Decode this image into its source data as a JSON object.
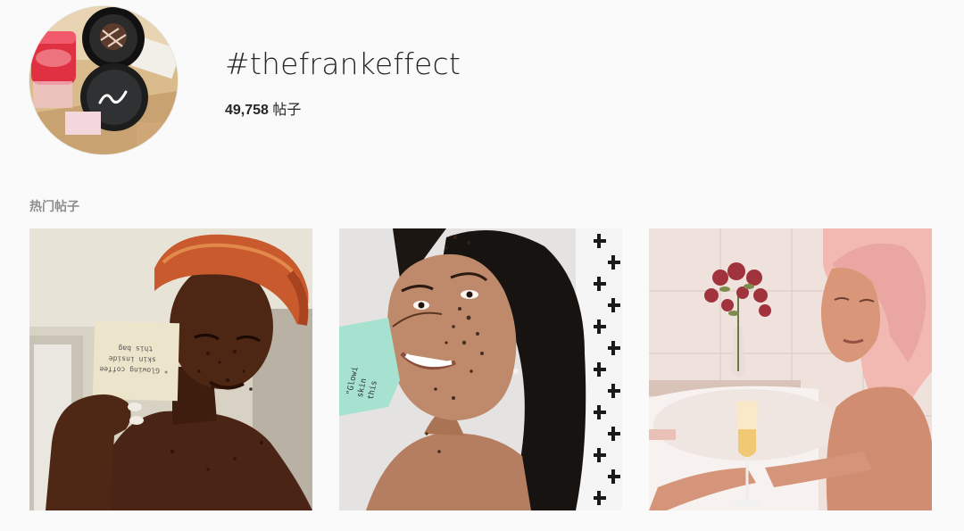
{
  "header": {
    "hashtag": "#thefrankeffect",
    "post_count": "49,758",
    "post_count_unit": "帖子"
  },
  "top_posts": {
    "section_label": "热门帖子",
    "posts": [
      {
        "photo_text": [
          "* Glowing coffee",
          "skin inside",
          "this bag"
        ]
      },
      {
        "photo_text": [
          "\"Glowi",
          "skin",
          "this"
        ]
      },
      {
        "photo_text": []
      }
    ]
  },
  "colors": {
    "background": "#fafafa",
    "text_primary": "#262626",
    "text_secondary": "#8e8e8e"
  }
}
